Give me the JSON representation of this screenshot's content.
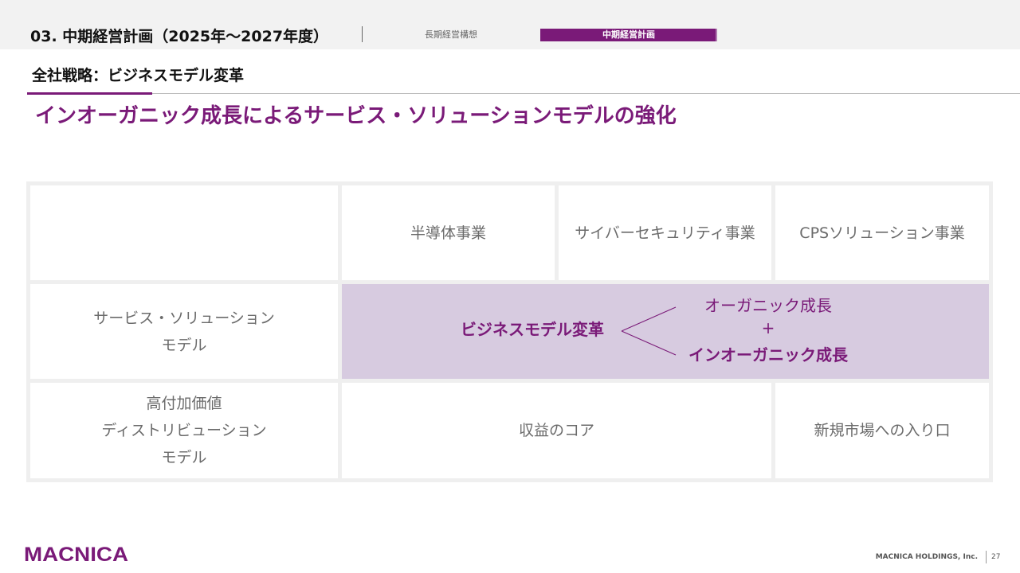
{
  "header": {
    "section_title": "03. 中期経営計画（2025年～2027年度）",
    "nav": [
      {
        "label": "長期経営構想",
        "active": false
      },
      {
        "label": "中期経営計画",
        "active": true
      }
    ]
  },
  "subtitle": "全社戦略：ビジネスモデル変革",
  "headline": "インオーガニック成長によるサービス・ソリューションモデルの強化",
  "matrix": {
    "columns": [
      "半導体事業",
      "サイバーセキュリティ事業",
      "CPSソリューション事業"
    ],
    "rows": [
      {
        "line1": "サービス・ソリューション",
        "line2": "モデル"
      },
      {
        "line1": "高付加価値",
        "line2": "ディストリビューション",
        "line3": "モデル"
      }
    ],
    "highlight": {
      "left": "ビジネスモデル変革",
      "top": "オーガニック成長",
      "plus": "+",
      "bottom": "インオーガニック成長"
    },
    "cells": {
      "core": "収益のコア",
      "entry": "新規市場への入り口"
    }
  },
  "footer": {
    "logo_text": "MACNICA",
    "company": "MACNICA HOLDINGS, Inc.",
    "page": "27"
  },
  "colors": {
    "brand_purple": "#7a1a78",
    "highlight_bg": "#d7cbe0",
    "grid_bg": "#efefef"
  }
}
